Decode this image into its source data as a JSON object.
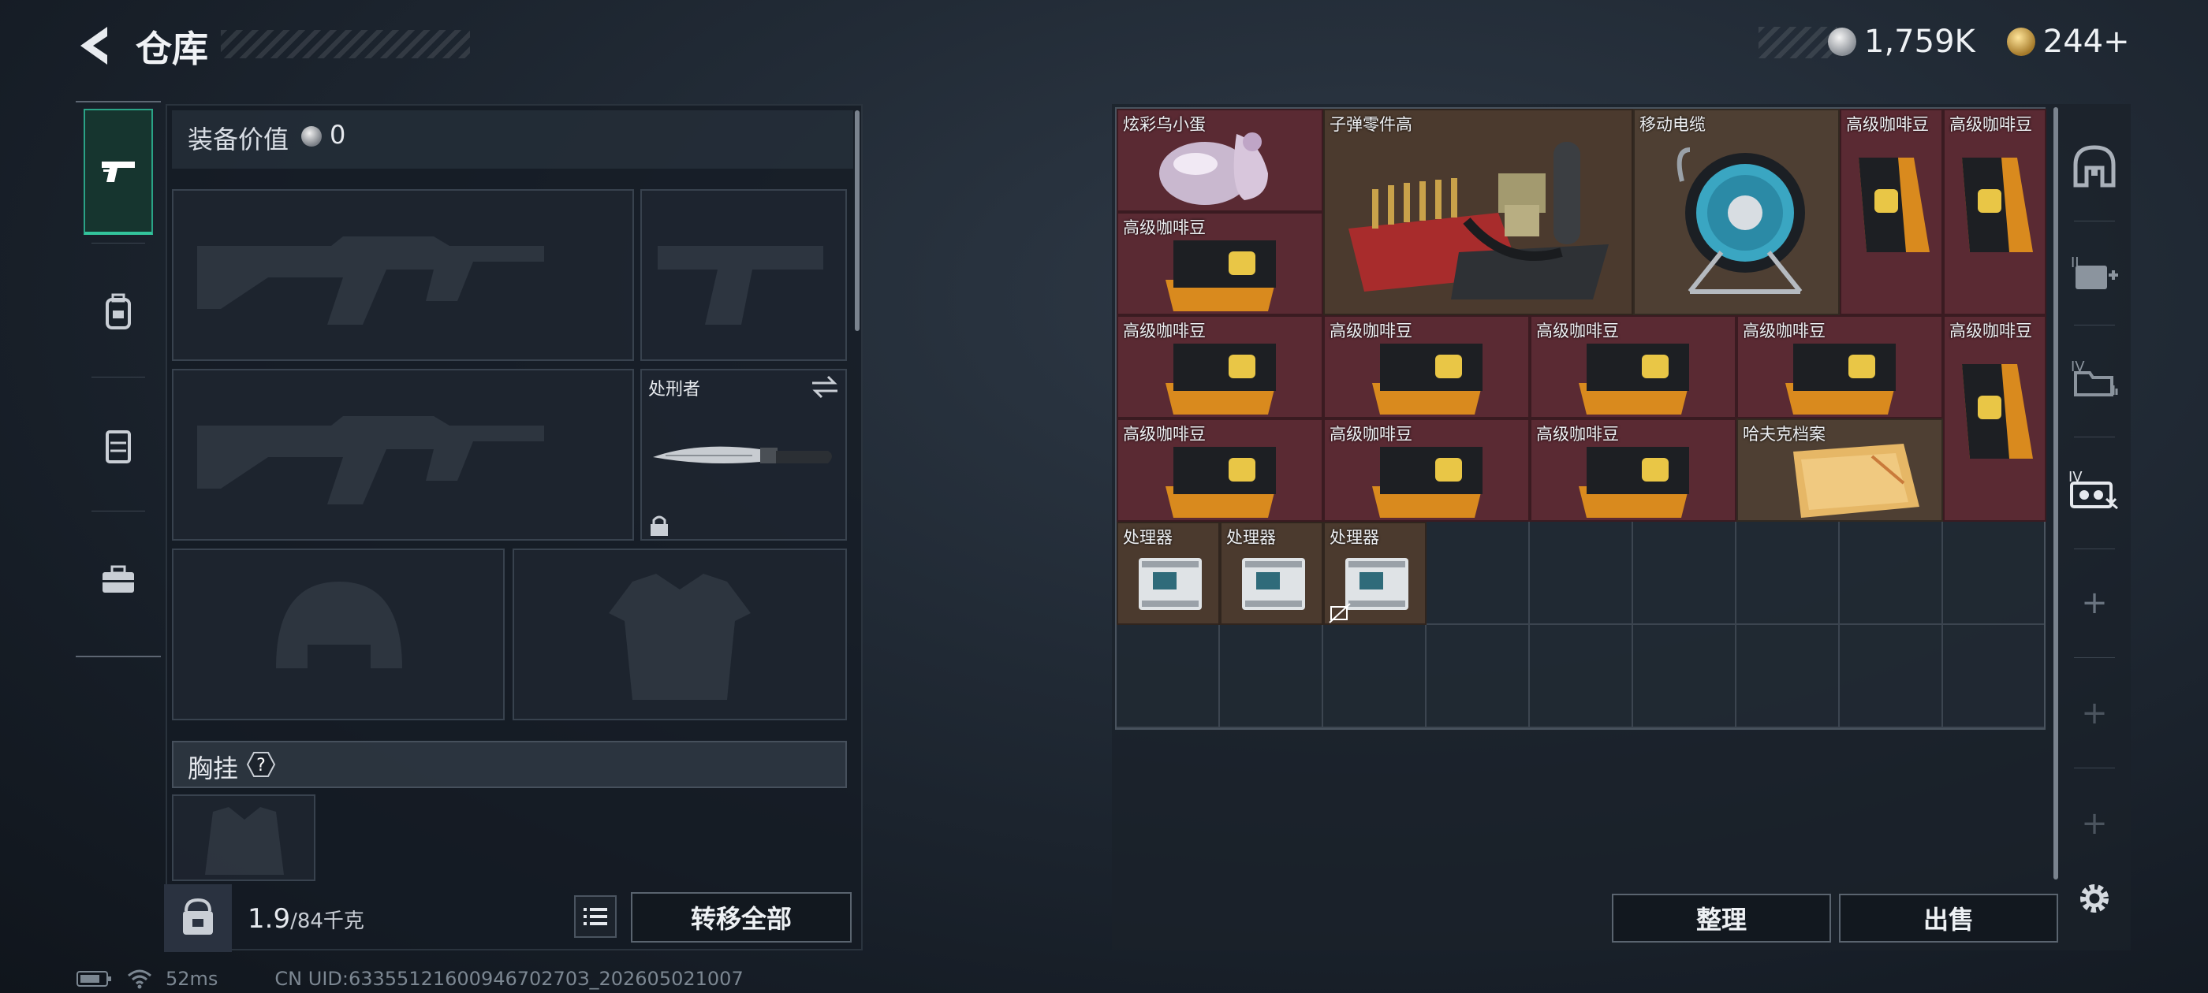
{
  "header": {
    "title": "仓库",
    "back_icon": "back-arrow-icon"
  },
  "currency": {
    "silver": {
      "icon": "silver-coin-icon",
      "value": "1,759K"
    },
    "gold": {
      "icon": "gold-coin-icon",
      "value": "244+"
    }
  },
  "left_rail": {
    "items": [
      {
        "icon": "pistol-icon",
        "active": true
      },
      {
        "icon": "backpack-icon",
        "active": false
      },
      {
        "icon": "vest-icon",
        "active": false
      },
      {
        "icon": "toolbox-icon",
        "active": false
      }
    ]
  },
  "equipment": {
    "value_label": "装备价值",
    "value": "0",
    "melee_label": "处刑者",
    "chest_label": "胸挂",
    "chest_help": "?",
    "weight_value": "1.9",
    "weight_max": "/84千克",
    "transfer_all": "转移全部"
  },
  "stash": {
    "items": [
      {
        "name": "炫彩乌小蛋",
        "color": "#5a2a33"
      },
      {
        "name": "子弹零件高",
        "color": "#4b3a2e"
      },
      {
        "name": "移动电缆",
        "color": "#4e3f33"
      },
      {
        "name": "高级咖啡豆",
        "color": "#5a2a33"
      },
      {
        "name": "高级咖啡豆",
        "color": "#5a2a33"
      },
      {
        "name": "高级咖啡豆",
        "color": "#5a2a33"
      },
      {
        "name": "高级咖啡豆",
        "color": "#5a2a33"
      },
      {
        "name": "高级咖啡豆",
        "color": "#5a2a33"
      },
      {
        "name": "高级咖啡豆",
        "color": "#5a2a33"
      },
      {
        "name": "高级咖啡豆",
        "color": "#5a2a33"
      },
      {
        "name": "高级咖啡豆",
        "color": "#5a2a33"
      },
      {
        "name": "高级咖啡豆",
        "color": "#5a2a33"
      },
      {
        "name": "高级咖啡豆",
        "color": "#5a2a33"
      },
      {
        "name": "高级咖啡豆",
        "color": "#5a2a33"
      },
      {
        "name": "哈夫克档案",
        "color": "#4e3f33"
      },
      {
        "name": "处理器",
        "color": "#4b3a2e"
      },
      {
        "name": "处理器",
        "color": "#4b3a2e"
      },
      {
        "name": "处理器",
        "color": "#4b3a2e"
      }
    ],
    "sort_button": "整理",
    "sell_button": "出售"
  },
  "right_tabs": {
    "items": [
      {
        "icon": "stash-arch-icon"
      },
      {
        "icon": "medkit-tier-icon"
      },
      {
        "icon": "folder-tier-icon"
      },
      {
        "icon": "cassette-tier-icon"
      },
      {
        "icon": "add-tab-icon"
      },
      {
        "icon": "add-tab-icon"
      },
      {
        "icon": "add-tab-icon"
      },
      {
        "icon": "settings-gear-icon"
      }
    ]
  },
  "status_bar": {
    "ping": "52ms",
    "uid": "CN UID:6335512160094670270З_202605021007"
  }
}
